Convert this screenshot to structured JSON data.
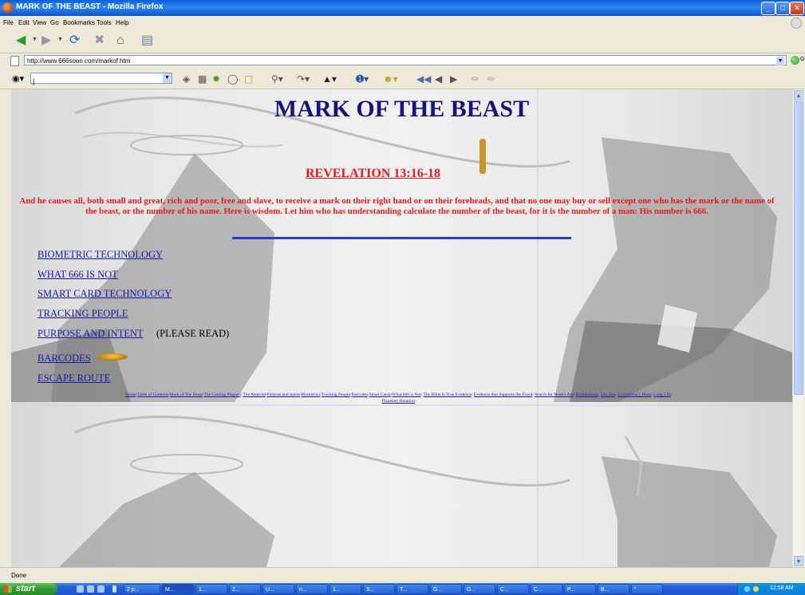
{
  "window": {
    "title": "MARK OF THE BEAST - Mozilla Firefox",
    "controls": {
      "minimize": "_",
      "maximize": "□",
      "close": "×"
    }
  },
  "menubar": {
    "items": [
      "File",
      "Edit",
      "View",
      "Go",
      "Bookmarks",
      "Tools",
      "Help"
    ]
  },
  "navbar": {
    "icons": [
      "back-icon",
      "forward-icon",
      "reload-icon",
      "stop-icon",
      "home-icon",
      "history-icon"
    ]
  },
  "address": {
    "url": "http://www.666soon.com/markof.htm",
    "go_label": "Go"
  },
  "search": {
    "value": "|"
  },
  "page": {
    "title": "MARK OF THE BEAST",
    "verse_ref": "REVELATION 13:16-18",
    "verse_text": "And he causes all, both small and great, rich and poor, free and slave, to receive a mark on their right hand or on their foreheads, and that no one may buy or sell except one who has the mark or the name of the beast, or the number of his name. Here is wisdom. Let him who has understanding calculate the number of the beast, for it is the number of a man: His number is 666.",
    "links": [
      "BIOMETRIC TECHNOLOGY",
      "WHAT 666 IS NOT",
      "SMART CARD TECHNOLOGY",
      "TRACKING PEOPLE",
      "PURPOSE AND INTENT",
      "BARCODES",
      "ESCAPE ROUTE"
    ],
    "please_read": "(PLEASE READ)",
    "footer_links": [
      "Home",
      "Table of Contents",
      "Mark of The Beast",
      "The Coming Plagues",
      "The Asteroid",
      "Purpose and Intent",
      "Biometrics",
      "Tracking People",
      "Barcodes",
      "Smart Cards",
      "What 666 is Not",
      "The Bible Is True Evidence",
      "Evidence that Supports the Flood",
      "Search for Noah's Ark",
      "Brendarthals",
      "Our Sun",
      "Evolutionary Hoax",
      "Long Life",
      "Planetary Rotation"
    ]
  },
  "status": {
    "text": "Done"
  },
  "taskbar": {
    "start_label": "start",
    "buttons": [
      "2 p...",
      "M...",
      "1...",
      "2...",
      "U...",
      "n...",
      "1...",
      "S...",
      "T...",
      "G...",
      "G...",
      "C...",
      "C...",
      "P...",
      "B...",
      "\""
    ],
    "clock": "12:58 AM"
  },
  "colors": {
    "title_blue": "#14147a",
    "verse_red": "#e51a1a",
    "link_blue": "#1a1aa6",
    "rule_blue": "#2a3bd6"
  }
}
